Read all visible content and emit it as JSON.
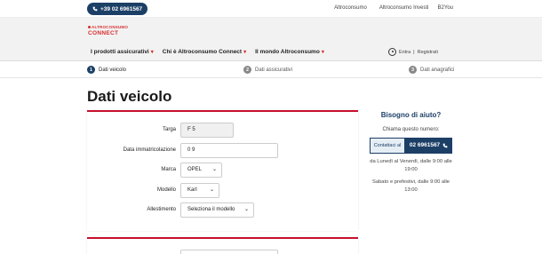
{
  "topbar": {
    "phone": "+39 02 6961567",
    "links": [
      "Altroconsumo",
      "Altroconsumo Investi",
      "B2You"
    ]
  },
  "logo": {
    "top": "ALTROCONSUMO",
    "bottom": "CONNECT"
  },
  "nav": {
    "items": [
      "I prodotti assicurativi",
      "Chi è Altroconsumo Connect",
      "Il mondo Altroconsumo"
    ],
    "login": "Entra",
    "register": "Registrati"
  },
  "steps": [
    {
      "num": "1",
      "label": "Dati veicolo"
    },
    {
      "num": "2",
      "label": "Dati assicurativi"
    },
    {
      "num": "3",
      "label": "Dati anagrafici"
    }
  ],
  "page": {
    "title": "Dati veicolo"
  },
  "form": {
    "targa_label": "Targa",
    "targa_value": "F          5",
    "immatricolazione_label": "Data immatricolazione",
    "immatricolazione_value": "0          9",
    "marca_label": "Marca",
    "marca_value": "OPEL",
    "modello_label": "Modello",
    "modello_value": "Karl",
    "allestimento_label": "Allestimento",
    "allestimento_value": "Seleziona il modello"
  },
  "help": {
    "title": "Bisogno di aiuto?",
    "subtitle": "Chiama questo numero:",
    "contact_label": "Contattaci al",
    "phone": "02 6961567",
    "hours_week": "da Lunedì al Venerdì, dalle 9:00 alle 19:00",
    "hours_weekend": "Sabato e prefestivi, dalle 9:00 alle 13:00"
  }
}
